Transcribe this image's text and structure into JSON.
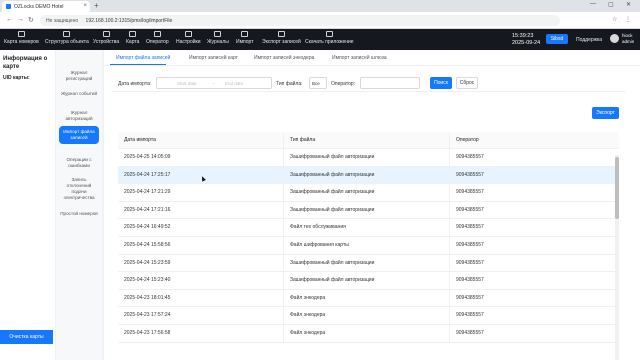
{
  "browser": {
    "tab_title": "OZLocks DEMO Hotel",
    "new_tab": "+",
    "security": "Не защищено",
    "url": "192.168.100.2:1315/pms/log/importFile"
  },
  "header": {
    "menu": [
      {
        "label": "Карта номеров",
        "icon": "room-map-icon"
      },
      {
        "label": "Структура объекта",
        "icon": "structure-icon"
      },
      {
        "label": "Устройства",
        "icon": "devices-icon"
      },
      {
        "label": "Карта",
        "icon": "card-icon"
      },
      {
        "label": "Оператор",
        "icon": "operator-icon"
      },
      {
        "label": "Настройки",
        "icon": "settings-icon"
      },
      {
        "label": "Журналы",
        "icon": "logs-icon"
      },
      {
        "label": "Импорт",
        "icon": "import-icon"
      },
      {
        "label": "Экспорт записей",
        "icon": "export-icon"
      },
      {
        "label": "Скачать приложение",
        "icon": "download-icon"
      }
    ],
    "time": "15:39:23",
    "date": "2025-09-24",
    "button": "Sibsd",
    "support": "Поддержка",
    "user_line1": "hiock",
    "user_line2": "admin"
  },
  "info_panel": {
    "title": "Информация о карте",
    "uid_label": "UID карты:",
    "clear_button": "Очистка карты"
  },
  "sidenav": [
    {
      "label": "Журнал регистраций",
      "active": false
    },
    {
      "label": "Журнал событий",
      "active": false
    },
    {
      "label": "Журнал авторизаций",
      "active": false
    },
    {
      "label": "Импорт файла записей",
      "active": true
    },
    {
      "label": "Операции с ошибками",
      "active": false
    },
    {
      "label": "Запись отклонений подачи электричества",
      "active": false
    },
    {
      "label": "Простой номеров",
      "active": false
    }
  ],
  "subtabs": [
    "Импорт файла записей",
    "Импорт записей карт",
    "Импорт записей энкодера",
    "Импорт записей шлюза"
  ],
  "filters": {
    "date_label": "Дата импорта:",
    "start_placeholder": "Start date",
    "range_sep": "-",
    "end_placeholder": "End date",
    "type_label": "Тип файла:",
    "type_value": "Все",
    "operator_label": "Оператор:",
    "search_button": "Поиск",
    "reset_button": "Сброс"
  },
  "export_button": "Экспорт",
  "table": {
    "columns": [
      "Дата импорта",
      "Тип файла",
      "Оператор"
    ],
    "rows": [
      [
        "2025-04-25 14:05:09",
        "Зашифрованный файл авторизации",
        "9094385557"
      ],
      [
        "2025-04-24 17:25:17",
        "Зашифрованный файл авторизации",
        "9094385557"
      ],
      [
        "2025-04-24 17:21:29",
        "Зашифрованный файл авторизации",
        "9094385557"
      ],
      [
        "2025-04-24 17:21:16",
        "Зашифрованный файл авторизации",
        "9094385557"
      ],
      [
        "2025-04-24 16:49:52",
        "Файл тех обслуживания",
        "9094385557"
      ],
      [
        "2025-04-24 15:58:56",
        "Файл шифрования карты",
        "9094385557"
      ],
      [
        "2025-04-24 15:23:59",
        "Зашифрованный файл авторизации",
        "9094385557"
      ],
      [
        "2025-04-24 15:23:40",
        "Зашифрованный файл авторизации",
        "9094385557"
      ],
      [
        "2025-04-23 18:01:45",
        "Файл энкодера",
        "9094385557"
      ],
      [
        "2025-04-23 17:57:24",
        "Файл энкодера",
        "9094385557"
      ],
      [
        "2025-04-23 17:56:58",
        "Файл энкодера",
        "9094385557"
      ]
    ]
  },
  "colors": {
    "accent": "#1677ff",
    "header_bg": "#15181f",
    "row_highlight": "#e6f4ff"
  }
}
